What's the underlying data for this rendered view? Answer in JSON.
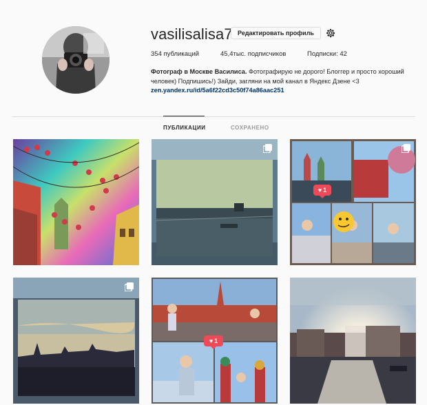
{
  "profile": {
    "username": "vasilisalisa77",
    "edit_button": "Редактировать профиль",
    "settings_icon": "gear-icon",
    "stats": {
      "posts": "354 публикаций",
      "followers": "45,4тыс. подписчиков",
      "following": "Подписки: 42"
    },
    "bio": {
      "name": "Фотограф в Москве Василиса.",
      "text": "Фотографирую не дорого! Блоггер и просто хороший человек) Подпишись!) Зайди, загляни на мой канал в Яндекс Дзене <3",
      "link": "zen.yandex.ru/id/5a6f22cd3c50f74a86aac251"
    }
  },
  "tabs": [
    {
      "label": "ПУБЛИКАЦИИ",
      "active": true
    },
    {
      "label": "СОХРАНЕНО",
      "active": false
    }
  ],
  "posts": [
    {
      "subject": "street-lights-decor",
      "multi": false
    },
    {
      "subject": "river-embankment",
      "multi": true
    },
    {
      "subject": "red-square-collage",
      "multi": true,
      "notification": "1"
    },
    {
      "subject": "kremlin-skyline",
      "multi": true
    },
    {
      "subject": "kremlin-collage",
      "multi": false,
      "notification": "1"
    },
    {
      "subject": "river-sunset",
      "multi": false
    }
  ],
  "colors": {
    "accent": "#003569",
    "notification": "#ed4956",
    "divider": "#dbdbdb",
    "background": "#fafafa"
  }
}
